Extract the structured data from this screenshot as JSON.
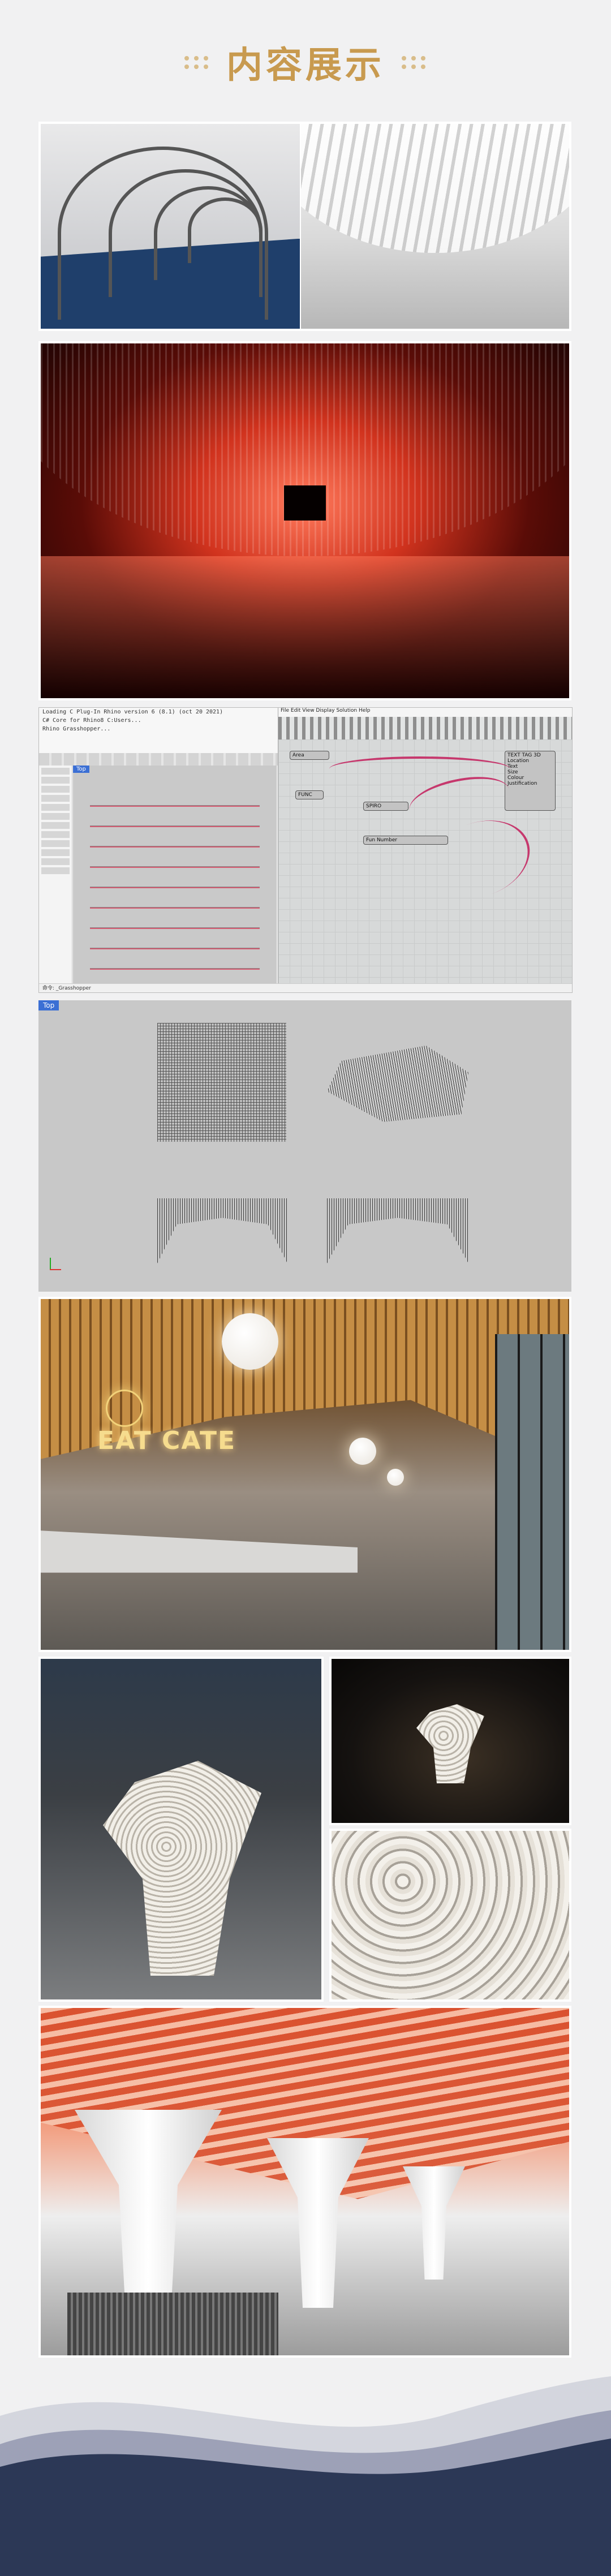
{
  "header": {
    "title": "内容展示"
  },
  "software": {
    "line1": "Loading C Plug-In Rhino version 6 (8.1) (oct 20 2021)",
    "line2": "C# Core for Rhino8 C:Users...",
    "line3": "Rhino Grasshopper...",
    "viewport_tab": "Top",
    "gh_menu": "File  Edit  View  Display  Solution  Help",
    "node_1": "Area",
    "node_2": "FUNC",
    "node_3": "SPIRO",
    "node_4": "Fun Number",
    "node_5": "TEXT TAG 3D",
    "node_5_items": [
      "Location",
      "Text",
      "Size",
      "Colour",
      "Justification"
    ],
    "status": "命令: _Grasshopper"
  },
  "viewport": {
    "tab": "Top"
  },
  "restaurant": {
    "logo_text": "EAT CATE"
  },
  "colors": {
    "accent": "#c89a4f",
    "accent_dots": "#d9bd8a",
    "footer_dark": "#2c3856"
  }
}
